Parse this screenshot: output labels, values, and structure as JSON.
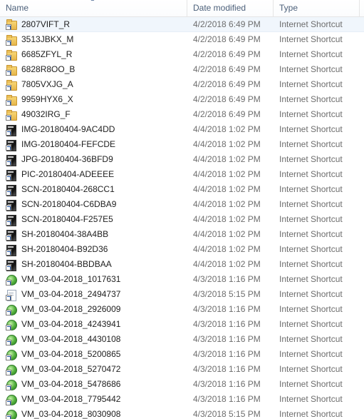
{
  "columns": {
    "name": "Name",
    "date": "Date modified",
    "type": "Type"
  },
  "sort_icon": "chevron-up-icon",
  "files": [
    {
      "name": "2807VIFT_R",
      "date": "4/2/2018 6:49 PM",
      "type": "Internet Shortcut",
      "icon": "folder"
    },
    {
      "name": "3513JBKX_M",
      "date": "4/2/2018 6:49 PM",
      "type": "Internet Shortcut",
      "icon": "folder"
    },
    {
      "name": "6685ZFYL_R",
      "date": "4/2/2018 6:49 PM",
      "type": "Internet Shortcut",
      "icon": "folder"
    },
    {
      "name": "6828R8OO_B",
      "date": "4/2/2018 6:49 PM",
      "type": "Internet Shortcut",
      "icon": "folder"
    },
    {
      "name": "7805VXJG_A",
      "date": "4/2/2018 6:49 PM",
      "type": "Internet Shortcut",
      "icon": "folder"
    },
    {
      "name": "9959HYX6_X",
      "date": "4/2/2018 6:49 PM",
      "type": "Internet Shortcut",
      "icon": "folder"
    },
    {
      "name": "49032IRG_F",
      "date": "4/2/2018 6:49 PM",
      "type": "Internet Shortcut",
      "icon": "folder"
    },
    {
      "name": "IMG-20180404-9AC4DD",
      "date": "4/4/2018 1:02 PM",
      "type": "Internet Shortcut",
      "icon": "image"
    },
    {
      "name": "IMG-20180404-FEFCDE",
      "date": "4/4/2018 1:02 PM",
      "type": "Internet Shortcut",
      "icon": "image"
    },
    {
      "name": "JPG-20180404-36BFD9",
      "date": "4/4/2018 1:02 PM",
      "type": "Internet Shortcut",
      "icon": "image"
    },
    {
      "name": "PIC-20180404-ADEEEE",
      "date": "4/4/2018 1:02 PM",
      "type": "Internet Shortcut",
      "icon": "image"
    },
    {
      "name": "SCN-20180404-268CC1",
      "date": "4/4/2018 1:02 PM",
      "type": "Internet Shortcut",
      "icon": "image"
    },
    {
      "name": "SCN-20180404-C6DBA9",
      "date": "4/4/2018 1:02 PM",
      "type": "Internet Shortcut",
      "icon": "image"
    },
    {
      "name": "SCN-20180404-F257E5",
      "date": "4/4/2018 1:02 PM",
      "type": "Internet Shortcut",
      "icon": "image"
    },
    {
      "name": "SH-20180404-38A4BB",
      "date": "4/4/2018 1:02 PM",
      "type": "Internet Shortcut",
      "icon": "image"
    },
    {
      "name": "SH-20180404-B92D36",
      "date": "4/4/2018 1:02 PM",
      "type": "Internet Shortcut",
      "icon": "image"
    },
    {
      "name": "SH-20180404-BBDBAA",
      "date": "4/4/2018 1:02 PM",
      "type": "Internet Shortcut",
      "icon": "image"
    },
    {
      "name": "VM_03-04-2018_1017631",
      "date": "4/3/2018 1:16 PM",
      "type": "Internet Shortcut",
      "icon": "globe"
    },
    {
      "name": "VM_03-04-2018_2494737",
      "date": "4/3/2018 5:15 PM",
      "type": "Internet Shortcut",
      "icon": "page"
    },
    {
      "name": "VM_03-04-2018_2926009",
      "date": "4/3/2018 1:16 PM",
      "type": "Internet Shortcut",
      "icon": "globe"
    },
    {
      "name": "VM_03-04-2018_4243941",
      "date": "4/3/2018 1:16 PM",
      "type": "Internet Shortcut",
      "icon": "globe"
    },
    {
      "name": "VM_03-04-2018_4430108",
      "date": "4/3/2018 1:16 PM",
      "type": "Internet Shortcut",
      "icon": "globe"
    },
    {
      "name": "VM_03-04-2018_5200865",
      "date": "4/3/2018 1:16 PM",
      "type": "Internet Shortcut",
      "icon": "globe"
    },
    {
      "name": "VM_03-04-2018_5270472",
      "date": "4/3/2018 1:16 PM",
      "type": "Internet Shortcut",
      "icon": "globe"
    },
    {
      "name": "VM_03-04-2018_5478686",
      "date": "4/3/2018 1:16 PM",
      "type": "Internet Shortcut",
      "icon": "globe"
    },
    {
      "name": "VM_03-04-2018_7795442",
      "date": "4/3/2018 1:16 PM",
      "type": "Internet Shortcut",
      "icon": "globe"
    },
    {
      "name": "VM_03-04-2018_8030908",
      "date": "4/3/2018 5:15 PM",
      "type": "Internet Shortcut",
      "icon": "globe"
    }
  ]
}
